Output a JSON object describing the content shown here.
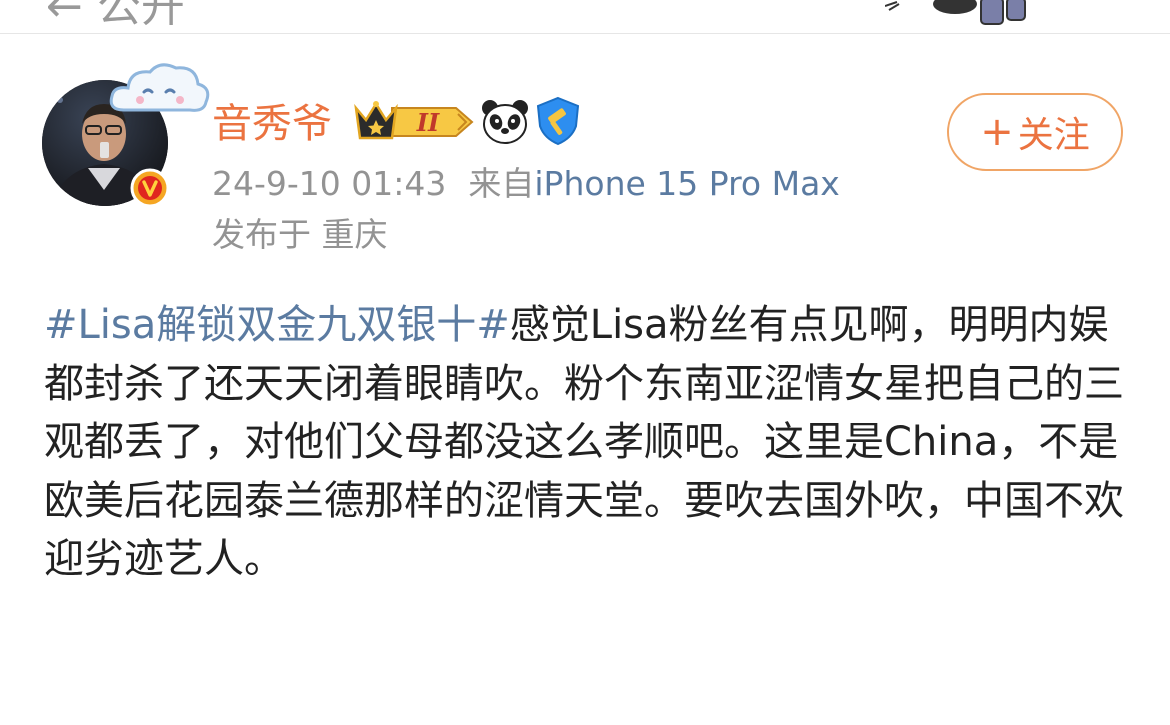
{
  "header": {
    "top_text": "← 公开"
  },
  "post": {
    "author": {
      "name": "音秀爷",
      "avatar_icon": "avatar-photo",
      "verified_icon": "v-verified-icon",
      "badges": [
        {
          "icon": "crown-vip-level-ii-icon",
          "label": "II"
        },
        {
          "icon": "panda-icon"
        },
        {
          "icon": "gavel-shield-icon"
        }
      ]
    },
    "follow_button": {
      "plus": "+",
      "label": "关注"
    },
    "meta": {
      "datetime": "24-9-10 01:43",
      "source_prefix": "来自",
      "source": "iPhone 15 Pro Max",
      "location": "发布于 重庆"
    },
    "content": {
      "hashtag": "#Lisa解锁双金九双银十#",
      "text": "感觉Lisa粉丝有点见啊，明明内娱都封杀了还天天闭着眼睛吹。粉个东南亚涩情女星把自己的三观都丢了，对他们父母都没这么孝顺吧。这里是China，不是欧美后花园泰兰德那样的涩情天堂。要吹去国外吹，中国不欢迎劣迹艺人。"
    }
  },
  "colors": {
    "username": "#eb7340",
    "link": "#5b7ba1",
    "meta": "#939393",
    "follow_border": "#f0a566"
  }
}
